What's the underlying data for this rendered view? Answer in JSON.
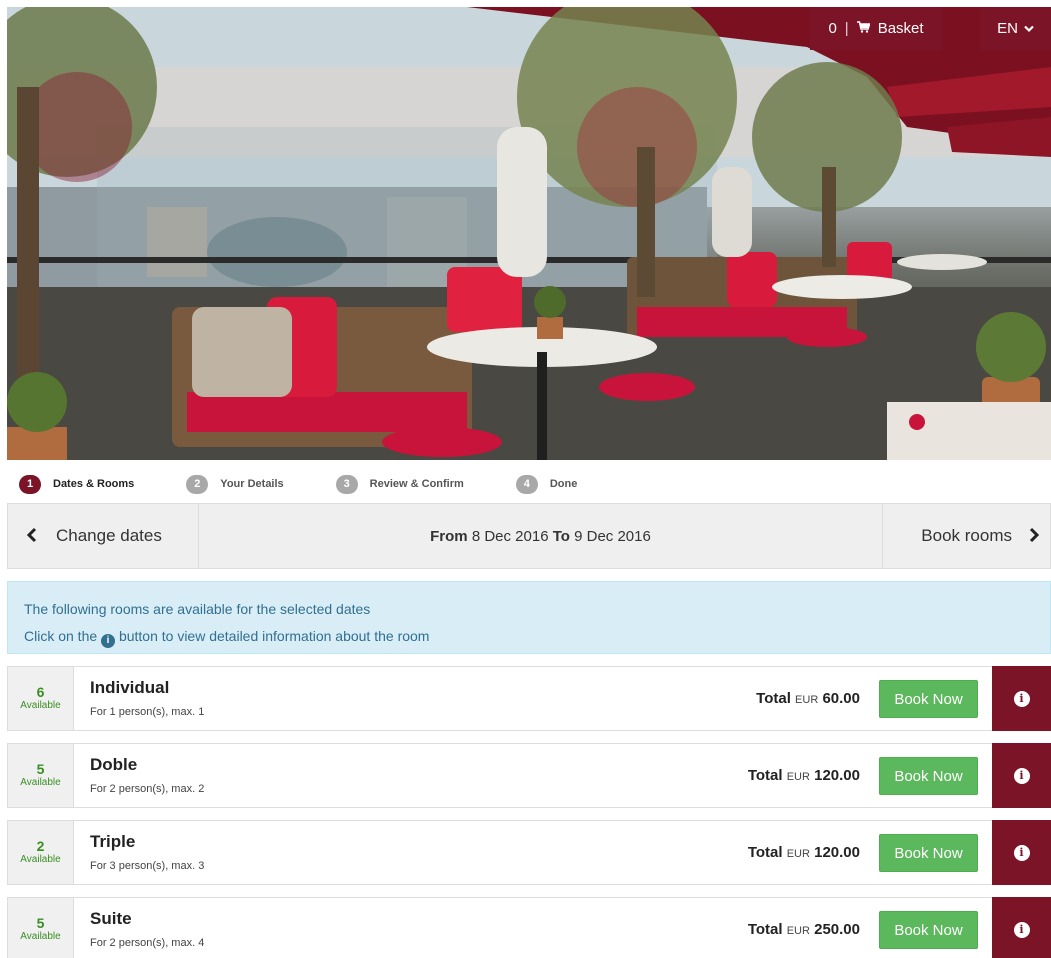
{
  "header": {
    "basket_count": "0",
    "basket_label": "Basket",
    "language": "EN"
  },
  "steps": [
    {
      "num": "1",
      "label": "Dates & Rooms"
    },
    {
      "num": "2",
      "label": "Your Details"
    },
    {
      "num": "3",
      "label": "Review & Confirm"
    },
    {
      "num": "4",
      "label": "Done"
    }
  ],
  "nav": {
    "prev_label": "Change dates",
    "from_word": "From",
    "from_date": "8 Dec 2016",
    "to_word": "To",
    "to_date": "9 Dec 2016",
    "next_label": "Book rooms"
  },
  "alert": {
    "line1": "The following rooms are available for the selected dates",
    "line2_pre": "Click on the",
    "line2_post": "button to view detailed information about the room"
  },
  "rooms": [
    {
      "available": "6",
      "available_label": "Available",
      "name": "Individual",
      "desc": "For 1 person(s), max. 1",
      "total_label": "Total",
      "currency": "EUR",
      "price": "60.00",
      "book_label": "Book Now"
    },
    {
      "available": "5",
      "available_label": "Available",
      "name": "Doble",
      "desc": "For 2 person(s), max. 2",
      "total_label": "Total",
      "currency": "EUR",
      "price": "120.00",
      "book_label": "Book Now"
    },
    {
      "available": "2",
      "available_label": "Available",
      "name": "Triple",
      "desc": "For 3 person(s), max. 3",
      "total_label": "Total",
      "currency": "EUR",
      "price": "120.00",
      "book_label": "Book Now"
    },
    {
      "available": "5",
      "available_label": "Available",
      "name": "Suite",
      "desc": "For 2 person(s), max. 4",
      "total_label": "Total",
      "currency": "EUR",
      "price": "250.00",
      "book_label": "Book Now"
    }
  ],
  "colors": {
    "brand": "#7b1426",
    "success": "#5cb85c",
    "available": "#3a8f23",
    "info_bg": "#d9edf7"
  },
  "icons": {
    "basket": "cart-icon",
    "language_dropdown": "chevron-down-icon",
    "prev": "chevron-left-icon",
    "next": "chevron-right-icon",
    "info": "info-circle-icon"
  }
}
